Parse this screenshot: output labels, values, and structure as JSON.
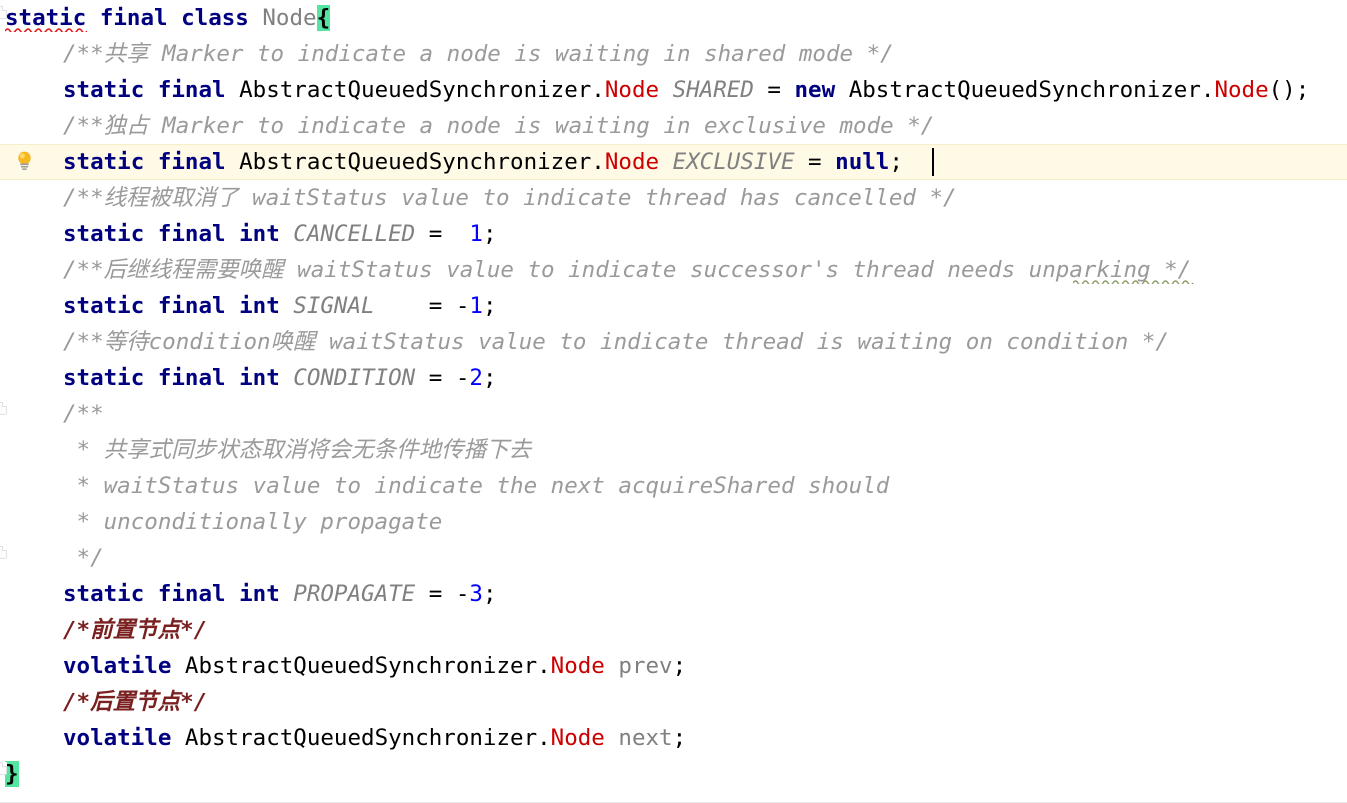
{
  "editor": {
    "language": "Java",
    "file_type": "java-class",
    "font_size_px": 22.5,
    "line_height_px": 36,
    "indent_text": "    "
  },
  "colors": {
    "background": "#ffffff",
    "keyword": "#000080",
    "class_reference": "#cc0000",
    "class_declaration": "#808080",
    "static_final_field": "#808080",
    "instance_field": "#808080",
    "number_literal": "#0000ff",
    "javadoc_comment": "#9a9a9a",
    "block_comment": "#7a2020",
    "plain_text": "#000000",
    "matching_brace_highlight": "#54e5a0",
    "current_line_highlight": "#fffae6",
    "error_squiggle": "#e01b1b",
    "typo_squiggle": "#8f9e6b"
  },
  "gutter": {
    "intention_bulb": {
      "icon": "lightbulb-icon",
      "tooltip": "Show Context Actions",
      "line_index": 4
    },
    "fold_markers": [
      {
        "icon": "fold-collapse-icon",
        "line_index": 0
      },
      {
        "icon": "fold-collapse-icon",
        "line_index": 13
      },
      {
        "icon": "fold-collapse-icon",
        "line_index": 17
      },
      {
        "icon": "fold-collapse-icon",
        "line_index": 21
      }
    ]
  },
  "annotations": {
    "error_underline": {
      "word": "static",
      "line_index": 0,
      "kind": "error"
    },
    "typo_underline": {
      "word": "unparking",
      "line_index": 7,
      "kind": "typo"
    }
  },
  "caret": {
    "line_index": 4,
    "after_text": "null;",
    "visible": true
  },
  "code_lines": [
    {
      "id": "line-1",
      "indent": 0,
      "tokens": [
        {
          "t": "static",
          "c": "kw"
        },
        {
          "t": " ",
          "c": "plain"
        },
        {
          "t": "final",
          "c": "kw"
        },
        {
          "t": " ",
          "c": "plain"
        },
        {
          "t": "class",
          "c": "kw"
        },
        {
          "t": " ",
          "c": "plain"
        },
        {
          "t": "Node",
          "c": "clsdecl"
        },
        {
          "t": "{",
          "c": "brace-hl"
        }
      ]
    },
    {
      "id": "line-2",
      "indent": 1,
      "tokens": [
        {
          "t": "/**共享 Marker to indicate a node is waiting in shared mode */",
          "c": "jdoc"
        }
      ]
    },
    {
      "id": "line-3",
      "indent": 1,
      "tokens": [
        {
          "t": "static",
          "c": "kw"
        },
        {
          "t": " ",
          "c": "plain"
        },
        {
          "t": "final",
          "c": "kw"
        },
        {
          "t": " ",
          "c": "plain"
        },
        {
          "t": "AbstractQueuedSynchronizer.",
          "c": "plain"
        },
        {
          "t": "Node",
          "c": "cls"
        },
        {
          "t": " ",
          "c": "plain"
        },
        {
          "t": "SHARED",
          "c": "sfield"
        },
        {
          "t": " = ",
          "c": "plain"
        },
        {
          "t": "new",
          "c": "kw"
        },
        {
          "t": " AbstractQueuedSynchronizer.",
          "c": "plain"
        },
        {
          "t": "Node",
          "c": "cls"
        },
        {
          "t": "();",
          "c": "plain"
        }
      ]
    },
    {
      "id": "line-4",
      "indent": 1,
      "tokens": [
        {
          "t": "/**独占 Marker to indicate a node is waiting in exclusive mode */",
          "c": "jdoc"
        }
      ]
    },
    {
      "id": "line-5",
      "indent": 1,
      "highlight": true,
      "tokens": [
        {
          "t": "static",
          "c": "kw"
        },
        {
          "t": " ",
          "c": "plain"
        },
        {
          "t": "final",
          "c": "kw"
        },
        {
          "t": " ",
          "c": "plain"
        },
        {
          "t": "AbstractQueuedSynchronizer.",
          "c": "plain"
        },
        {
          "t": "Node",
          "c": "cls"
        },
        {
          "t": " ",
          "c": "plain"
        },
        {
          "t": "EXCLUSIVE",
          "c": "sfield"
        },
        {
          "t": " = ",
          "c": "plain"
        },
        {
          "t": "null",
          "c": "kw"
        },
        {
          "t": ";",
          "c": "plain"
        }
      ]
    },
    {
      "id": "line-6",
      "indent": 1,
      "tokens": [
        {
          "t": "/**线程被取消了 waitStatus value to indicate thread has cancelled */",
          "c": "jdoc"
        }
      ]
    },
    {
      "id": "line-7",
      "indent": 1,
      "tokens": [
        {
          "t": "static",
          "c": "kw"
        },
        {
          "t": " ",
          "c": "plain"
        },
        {
          "t": "final",
          "c": "kw"
        },
        {
          "t": " ",
          "c": "plain"
        },
        {
          "t": "int",
          "c": "kw"
        },
        {
          "t": " ",
          "c": "plain"
        },
        {
          "t": "CANCELLED",
          "c": "sfield"
        },
        {
          "t": " =  ",
          "c": "plain"
        },
        {
          "t": "1",
          "c": "num"
        },
        {
          "t": ";",
          "c": "plain"
        }
      ]
    },
    {
      "id": "line-8",
      "indent": 1,
      "tokens": [
        {
          "t": "/**后继线程需要唤醒 waitStatus value to indicate successor's thread needs unparking */",
          "c": "jdoc"
        }
      ]
    },
    {
      "id": "line-9",
      "indent": 1,
      "tokens": [
        {
          "t": "static",
          "c": "kw"
        },
        {
          "t": " ",
          "c": "plain"
        },
        {
          "t": "final",
          "c": "kw"
        },
        {
          "t": " ",
          "c": "plain"
        },
        {
          "t": "int",
          "c": "kw"
        },
        {
          "t": " ",
          "c": "plain"
        },
        {
          "t": "SIGNAL",
          "c": "sfield"
        },
        {
          "t": "    = -",
          "c": "plain"
        },
        {
          "t": "1",
          "c": "num"
        },
        {
          "t": ";",
          "c": "plain"
        }
      ]
    },
    {
      "id": "line-10",
      "indent": 1,
      "tokens": [
        {
          "t": "/**等待condition唤醒 waitStatus value to indicate thread is waiting on condition */",
          "c": "jdoc"
        }
      ]
    },
    {
      "id": "line-11",
      "indent": 1,
      "tokens": [
        {
          "t": "static",
          "c": "kw"
        },
        {
          "t": " ",
          "c": "plain"
        },
        {
          "t": "final",
          "c": "kw"
        },
        {
          "t": " ",
          "c": "plain"
        },
        {
          "t": "int",
          "c": "kw"
        },
        {
          "t": " ",
          "c": "plain"
        },
        {
          "t": "CONDITION",
          "c": "sfield"
        },
        {
          "t": " = -",
          "c": "plain"
        },
        {
          "t": "2",
          "c": "num"
        },
        {
          "t": ";",
          "c": "plain"
        }
      ]
    },
    {
      "id": "line-12",
      "indent": 1,
      "tokens": [
        {
          "t": "/**",
          "c": "jdoc"
        }
      ]
    },
    {
      "id": "line-13",
      "indent": 1,
      "tokens": [
        {
          "t": " * 共享式同步状态取消将会无条件地传播下去",
          "c": "jdoc"
        }
      ]
    },
    {
      "id": "line-14",
      "indent": 1,
      "tokens": [
        {
          "t": " * waitStatus value to indicate the next acquireShared should",
          "c": "jdoc"
        }
      ]
    },
    {
      "id": "line-15",
      "indent": 1,
      "tokens": [
        {
          "t": " * unconditionally propagate",
          "c": "jdoc"
        }
      ]
    },
    {
      "id": "line-16",
      "indent": 1,
      "tokens": [
        {
          "t": " */",
          "c": "jdoc"
        }
      ]
    },
    {
      "id": "line-17",
      "indent": 1,
      "tokens": [
        {
          "t": "static",
          "c": "kw"
        },
        {
          "t": " ",
          "c": "plain"
        },
        {
          "t": "final",
          "c": "kw"
        },
        {
          "t": " ",
          "c": "plain"
        },
        {
          "t": "int",
          "c": "kw"
        },
        {
          "t": " ",
          "c": "plain"
        },
        {
          "t": "PROPAGATE",
          "c": "sfield"
        },
        {
          "t": " = -",
          "c": "plain"
        },
        {
          "t": "3",
          "c": "num"
        },
        {
          "t": ";",
          "c": "plain"
        }
      ]
    },
    {
      "id": "line-18",
      "indent": 1,
      "tokens": [
        {
          "t": "/*前置节点*/",
          "c": "bcom"
        }
      ]
    },
    {
      "id": "line-19",
      "indent": 1,
      "tokens": [
        {
          "t": "volatile",
          "c": "kw"
        },
        {
          "t": " AbstractQueuedSynchronizer.",
          "c": "plain"
        },
        {
          "t": "Node",
          "c": "cls"
        },
        {
          "t": " ",
          "c": "plain"
        },
        {
          "t": "prev",
          "c": "ifield"
        },
        {
          "t": ";",
          "c": "plain"
        }
      ]
    },
    {
      "id": "line-20",
      "indent": 1,
      "tokens": [
        {
          "t": "/*后置节点*/",
          "c": "bcom"
        }
      ]
    },
    {
      "id": "line-21",
      "indent": 1,
      "tokens": [
        {
          "t": "volatile",
          "c": "kw"
        },
        {
          "t": " AbstractQueuedSynchronizer.",
          "c": "plain"
        },
        {
          "t": "Node",
          "c": "cls"
        },
        {
          "t": " ",
          "c": "plain"
        },
        {
          "t": "next",
          "c": "ifield"
        },
        {
          "t": ";",
          "c": "plain"
        }
      ]
    },
    {
      "id": "line-22",
      "indent": 0,
      "tokens": [
        {
          "t": "}",
          "c": "brace-hl"
        }
      ]
    }
  ]
}
